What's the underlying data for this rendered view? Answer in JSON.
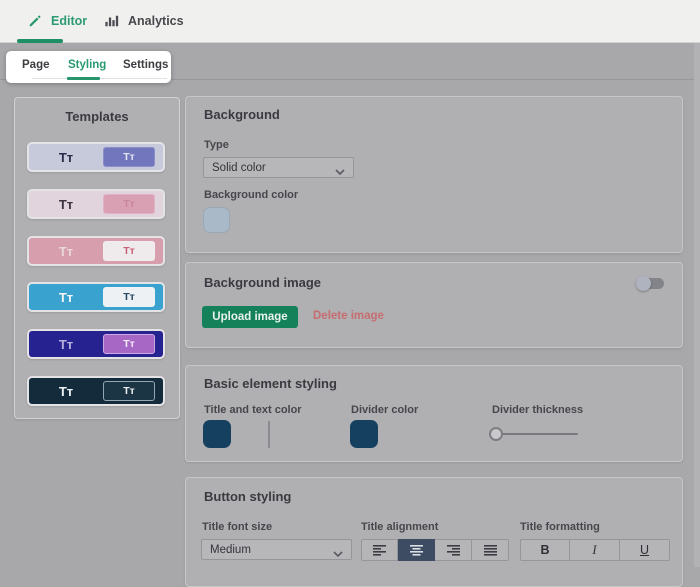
{
  "topbar": {
    "editor_tab": "Editor",
    "analytics_tab": "Analytics"
  },
  "subtabs": {
    "page": "Page",
    "styling": "Styling",
    "settings": "Settings",
    "active": "Styling"
  },
  "templates": {
    "title": "Templates",
    "sample_text": "Tт",
    "items": [
      {
        "bg": "#c6cadb",
        "text": "#2a2d49",
        "btn_bg": "#7277bd",
        "btn_text": "#e3e5f4",
        "btn_border": "#8a8fca"
      },
      {
        "bg": "#e2d4dc",
        "text": "#3a343f",
        "btn_bg": "#d9a0b3",
        "btn_text": "#c9849d",
        "btn_border": "#e0b2c2"
      },
      {
        "bg": "#d79fad",
        "text": "#e9d6db",
        "btn_bg": "#efebed",
        "btn_text": "#c76073",
        "btn_border": "#f2eef0"
      },
      {
        "bg": "#39a2cf",
        "text": "#f3f7f9",
        "btn_bg": "#edf1f3",
        "btn_text": "#274762",
        "btn_border": "#eff3f5"
      },
      {
        "bg": "#262290",
        "text": "#b6b2dc",
        "btn_bg": "#a767c5",
        "btn_text": "#f3ecf8",
        "btn_border": "#cfa9e3"
      },
      {
        "bg": "#132b3a",
        "text": "#eff2f4",
        "btn_bg": "#1c3545",
        "btn_text": "#edf0f2",
        "btn_border": "#93a7b2"
      }
    ]
  },
  "background": {
    "title": "Background",
    "type_label": "Type",
    "type_value": "Solid color",
    "color_label": "Background color",
    "swatch_color": "#a9b9c8"
  },
  "background_image": {
    "title": "Background image",
    "upload_label": "Upload image",
    "delete_label": "Delete image",
    "toggle_on": false
  },
  "basic_styling": {
    "title": "Basic element styling",
    "fields": [
      {
        "label": "Title and text color",
        "swatch": "#16405f"
      },
      {
        "label": "Divider color",
        "swatch": "#16405f"
      },
      {
        "label": "Divider thickness"
      }
    ],
    "divider_thickness_position": 0
  },
  "button_styling": {
    "title": "Button styling",
    "font_size_label": "Title font size",
    "font_size_value": "Medium",
    "alignment_label": "Title alignment",
    "alignment_options": [
      "left",
      "center",
      "right",
      "justify"
    ],
    "alignment_selected_index": 1,
    "formatting_label": "Title formatting",
    "formatting_buttons": [
      "B",
      "I",
      "U"
    ]
  },
  "colors": {
    "accent_green": "#1f8f68",
    "upload_green": "#15815a",
    "danger_red": "#c76d70",
    "selected_align_bg": "#3d4b63"
  }
}
